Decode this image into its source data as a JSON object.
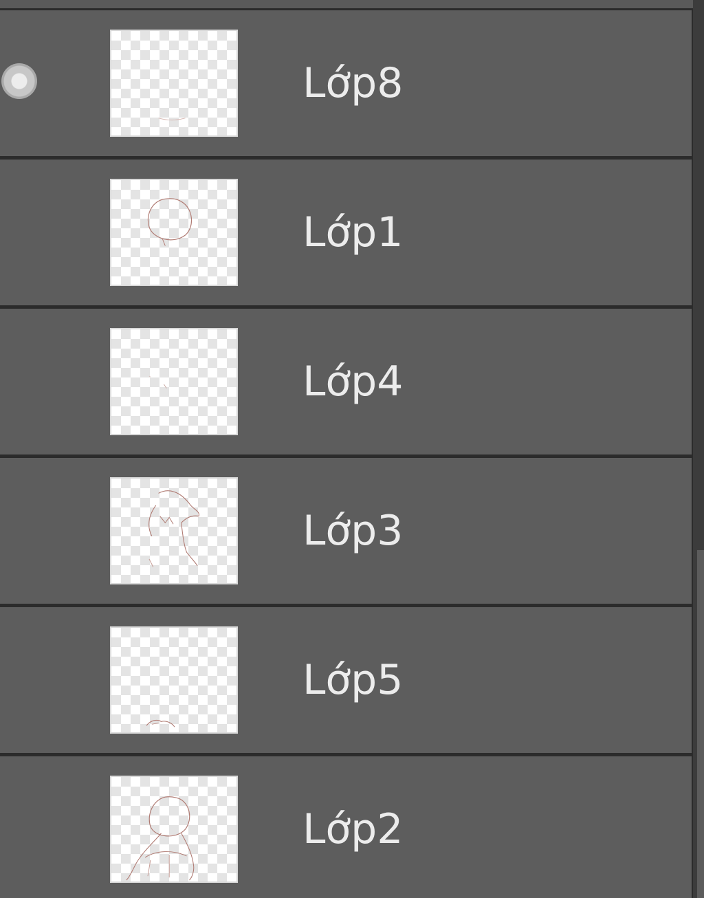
{
  "layers_panel": {
    "layers": [
      {
        "name": "Lớp8",
        "visible_indicator": true,
        "thumbnail": "empty-sketch"
      },
      {
        "name": "Lớp1",
        "visible_indicator": false,
        "thumbnail": "circle-sketch"
      },
      {
        "name": "Lớp4",
        "visible_indicator": false,
        "thumbnail": "tiny-mark"
      },
      {
        "name": "Lớp3",
        "visible_indicator": false,
        "thumbnail": "figure-sketch"
      },
      {
        "name": "Lớp5",
        "visible_indicator": false,
        "thumbnail": "bottom-mark"
      },
      {
        "name": "Lớp2",
        "visible_indicator": false,
        "thumbnail": "body-sketch"
      }
    ]
  },
  "colors": {
    "row_background": "#5d5d5d",
    "separator": "#2b2b2b",
    "text": "#ececec",
    "sketch_stroke": "#b07b73"
  }
}
